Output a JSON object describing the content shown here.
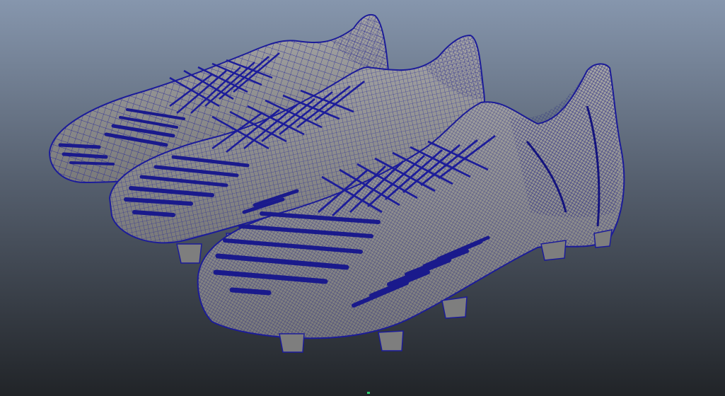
{
  "viewport": {
    "mode": "wireframe-on-shaded",
    "background_top": "#8696ad",
    "background_bottom": "#212428",
    "mesh_fill": "#8d8d8d",
    "wire_color": "#1c1c9a",
    "wire_dense_color": "#14147e"
  },
  "scene": {
    "objects": [
      {
        "name": "boot-back",
        "icon": "mesh-icon"
      },
      {
        "name": "boot-middle",
        "icon": "mesh-icon"
      },
      {
        "name": "boot-front",
        "icon": "mesh-icon"
      }
    ]
  },
  "axis_indicator": {
    "color": "#2ecc71"
  }
}
